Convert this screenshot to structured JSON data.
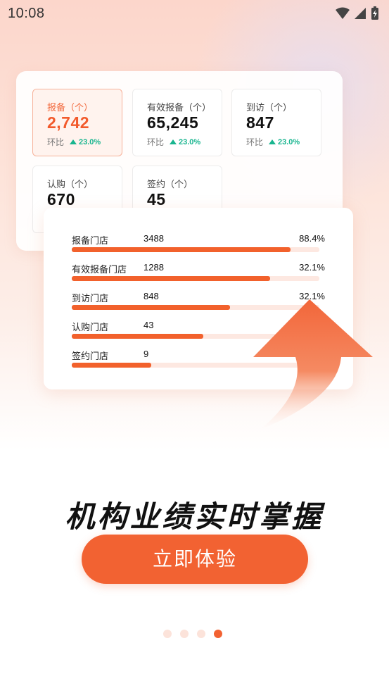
{
  "status_bar": {
    "time": "10:08"
  },
  "metrics": [
    {
      "label": "报备（个）",
      "value": "2,742",
      "compare_label": "环比",
      "change": "23.0%",
      "active": true
    },
    {
      "label": "有效报备（个）",
      "value": "65,245",
      "compare_label": "环比",
      "change": "23.0%"
    },
    {
      "label": "到访（个）",
      "value": "847",
      "compare_label": "环比",
      "change": "23.0%"
    },
    {
      "label": "认购（个）",
      "value": "670"
    },
    {
      "label": "签约（个）",
      "value": "45"
    }
  ],
  "stores": [
    {
      "label": "报备门店",
      "count": "3488",
      "percent": "88.4%",
      "fill": 0.884
    },
    {
      "label": "有效报备门店",
      "count": "1288",
      "percent": "32.1%",
      "fill": 0.8
    },
    {
      "label": "到访门店",
      "count": "848",
      "percent": "32.1%",
      "fill": 0.64
    },
    {
      "label": "认购门店",
      "count": "43",
      "percent": "",
      "fill": 0.53
    },
    {
      "label": "签约门店",
      "count": "9",
      "percent": "",
      "fill": 0.32
    }
  ],
  "headline": "机构业绩实时掌握",
  "cta_label": "立即体验",
  "pager": {
    "count": 4,
    "active_index": 3
  },
  "colors": {
    "accent": "#f26232",
    "positive": "#18b58f"
  }
}
